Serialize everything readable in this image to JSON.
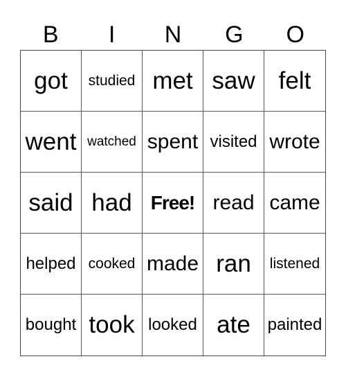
{
  "header": [
    "B",
    "I",
    "N",
    "G",
    "O"
  ],
  "cells": [
    [
      "got",
      "studied",
      "met",
      "saw",
      "felt"
    ],
    [
      "went",
      "watched",
      "spent",
      "visited",
      "wrote"
    ],
    [
      "said",
      "had",
      "Free!",
      "read",
      "came"
    ],
    [
      "helped",
      "cooked",
      "made",
      "ran",
      "listened"
    ],
    [
      "bought",
      "took",
      "looked",
      "ate",
      "painted"
    ]
  ]
}
